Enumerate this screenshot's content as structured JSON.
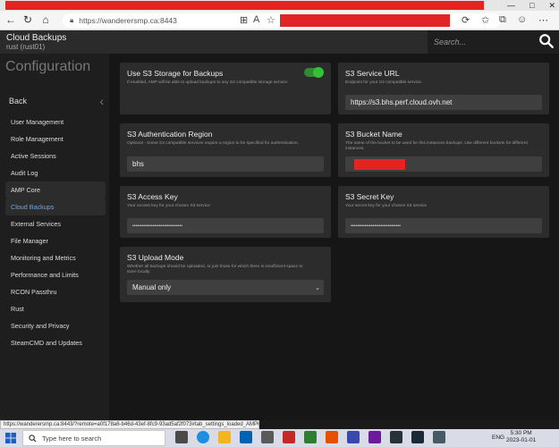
{
  "browser": {
    "url": "https://wanderersmp.ca:8443",
    "window_controls": [
      "—",
      "□",
      "✕"
    ]
  },
  "app": {
    "name": "Cloud Backups",
    "instance": "rust (rust01)",
    "search_placeholder": "Search..."
  },
  "sidebar": {
    "heading": "Configuration",
    "back_label": "Back",
    "items": [
      {
        "label": "User Management",
        "state": ""
      },
      {
        "label": "Role Management",
        "state": ""
      },
      {
        "label": "Active Sessions",
        "state": ""
      },
      {
        "label": "Audit Log",
        "state": ""
      },
      {
        "label": "AMP Core",
        "state": "dim"
      },
      {
        "label": "Cloud Backups",
        "state": "active"
      },
      {
        "label": "External Services",
        "state": ""
      },
      {
        "label": "File Manager",
        "state": ""
      },
      {
        "label": "Monitoring and Metrics",
        "state": ""
      },
      {
        "label": "Performance and Limits",
        "state": ""
      },
      {
        "label": "RCON Passthru",
        "state": ""
      },
      {
        "label": "Rust",
        "state": ""
      },
      {
        "label": "Security and Privacy",
        "state": ""
      },
      {
        "label": "SteamCMD and Updates",
        "state": ""
      }
    ]
  },
  "settings": {
    "use_s3": {
      "title": "Use S3 Storage for Backups",
      "desc": "If enabled, AMP will be able to upload backups to any S3 compatible storage service.",
      "enabled": true
    },
    "s3_url": {
      "title": "S3 Service URL",
      "desc": "Endpoint for your S3 compatible service.",
      "value": "https://s3.bhs.perf.cloud.ovh.net"
    },
    "s3_region": {
      "title": "S3 Authentication Region",
      "desc": "Optional - Some S3 compatible services require a region to be specified for authentication.",
      "value": "bhs"
    },
    "s3_bucket": {
      "title": "S3 Bucket Name",
      "desc": "The name of the bucket to be used for this instances backups. Use different buckets for different instances.",
      "value": ""
    },
    "s3_access_key": {
      "title": "S3 Access Key",
      "desc": "Your access key for your chosen S3 service",
      "value": "••••••••••••••••••••••••••••••••"
    },
    "s3_secret_key": {
      "title": "S3 Secret Key",
      "desc": "Your secret key for your chosen S3 service",
      "value": "••••••••••••••••••••••••••••••••"
    },
    "s3_upload_mode": {
      "title": "S3 Upload Mode",
      "desc": "Whether all backups should be uploaded, or just those for which there is insufficient space to store locally.",
      "value": "Manual only"
    }
  },
  "status_url": "https://wanderersmp.ca:8443/?remote=a0f178a6-b46d-43ef-8fc9-93ad5af2f073#tab_settings_loaded_AMPCore",
  "taskbar": {
    "search_placeholder": "Type here to search",
    "lang": "ENG",
    "time": "5:30 PM",
    "date": "2023-01-01"
  }
}
